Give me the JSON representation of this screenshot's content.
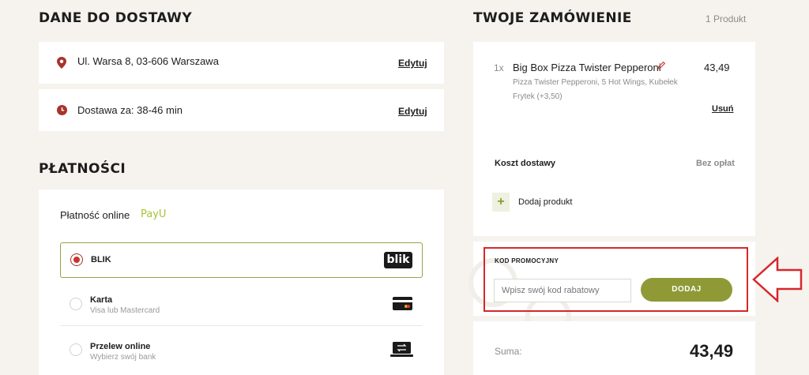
{
  "delivery": {
    "heading": "DANE DO DOSTAWY",
    "address": "Ul. Warsa 8, 03-606 Warszawa",
    "address_edit": "Edytuj",
    "time": "Dostawa za: 38-46 min",
    "time_edit": "Edytuj"
  },
  "payments": {
    "heading": "PŁATNOŚCI",
    "online_label": "Płatność online",
    "provider_logo": "PayU",
    "options": [
      {
        "title": "BLIK",
        "subtitle": "",
        "selected": true,
        "icon": "blik-logo"
      },
      {
        "title": "Karta",
        "subtitle": "Visa lub Mastercard",
        "selected": false,
        "icon": "card-icon"
      },
      {
        "title": "Przelew online",
        "subtitle": "Wybierz swój bank",
        "selected": false,
        "icon": "laptop-transfer-icon"
      }
    ],
    "blik_logo_text": "blik"
  },
  "order": {
    "heading": "TWOJE ZAMÓWIENIE",
    "count": "1 Produkt",
    "item": {
      "qty": "1x",
      "name": "Big Box Pizza Twister Pepperoni",
      "details": "Pizza Twister Pepperoni, 5 Hot Wings, Kubełek Frytek (+3,50)",
      "price": "43,49",
      "remove": "Usuń"
    },
    "delivery_cost_label": "Koszt dostawy",
    "delivery_cost_value": "Bez opłat",
    "add_product": "Dodaj produkt"
  },
  "promo": {
    "label": "KOD PROMOCYJNY",
    "placeholder": "Wpisz swój kod rabatowy",
    "button": "DODAJ"
  },
  "summary": {
    "label": "Suma:",
    "total": "43,49"
  },
  "colors": {
    "accent_red": "#c7362d",
    "olive_button": "#8f9a36",
    "payu_green": "#a6c437",
    "highlight_red": "#d6272b"
  }
}
